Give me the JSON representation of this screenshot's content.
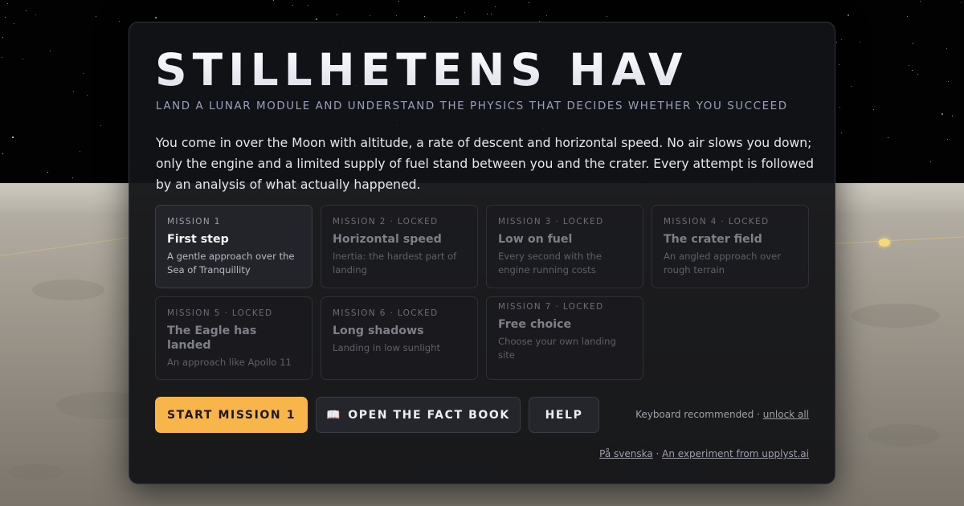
{
  "game": {
    "title": "STILLHETENS HAV",
    "subtitle": "LAND A LUNAR MODULE AND UNDERSTAND THE PHYSICS THAT DECIDES WHETHER YOU SUCCEED",
    "intro": "You come in over the Moon with altitude, a rate of descent and horizontal speed. No air slows you down; only the engine and a limited supply of fuel stand between you and the crater. Every attempt is followed by an analysis of what actually happened."
  },
  "missions": [
    {
      "kicker": "MISSION 1",
      "name": "First step",
      "desc": "A gentle approach over the Sea of Tranquillity",
      "locked": false
    },
    {
      "kicker": "MISSION 2 · LOCKED",
      "name": "Horizontal speed",
      "desc": "Inertia: the hardest part of landing",
      "locked": true
    },
    {
      "kicker": "MISSION 3 · LOCKED",
      "name": "Low on fuel",
      "desc": "Every second with the engine running costs",
      "locked": true
    },
    {
      "kicker": "MISSION 4 · LOCKED",
      "name": "The crater field",
      "desc": "An angled approach over rough terrain",
      "locked": true
    },
    {
      "kicker": "MISSION 5 · LOCKED",
      "name": "The Eagle has landed",
      "desc": "An approach like Apollo 11",
      "locked": true
    },
    {
      "kicker": "MISSION 6 · LOCKED",
      "name": "Long shadows",
      "desc": "Landing in low sunlight",
      "locked": true
    },
    {
      "kicker": "MISSION 7 · LOCKED",
      "name": "Free choice",
      "desc": "Choose your own landing site",
      "locked": true
    }
  ],
  "actions": {
    "start_label": "START MISSION 1",
    "factbook_icon": "📖",
    "factbook_label": "OPEN THE FACT BOOK",
    "help_label": "HELP"
  },
  "notes": {
    "keyboard": "Keyboard recommended",
    "separator": " · ",
    "unlock_all": "unlock all",
    "language": "På svenska",
    "experiment": "An experiment from upplyst.ai"
  },
  "colors": {
    "accent": "#f7b54a",
    "panel": "#121316",
    "sky": "#020203",
    "regolith": "#a49e93"
  },
  "icons": {
    "factbook": "book-icon",
    "landing_marker": "landing-marker-icon"
  }
}
